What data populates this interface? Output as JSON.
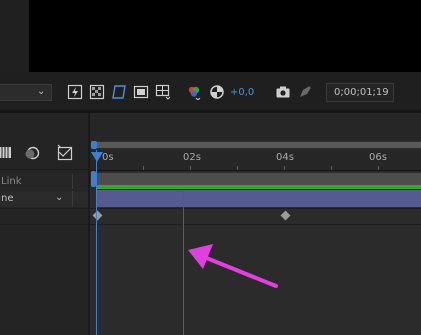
{
  "toolbar": {
    "zoom_value": "+0,0",
    "timecode": "0;00;01;19",
    "icons": [
      "fast-previews-icon",
      "transparency-grid-icon",
      "mask-visibility-icon",
      "region-of-interest-icon",
      "guides-grid-icon",
      "color-channels-icon",
      "exposure-reset-icon",
      "snapshot-camera-icon",
      "show-snapshot-icon"
    ]
  },
  "timeline": {
    "ruler_labels": [
      "0s",
      "02s",
      "04s",
      "06s"
    ],
    "column_header": {
      "parent_link_label": "Link"
    },
    "layer": {
      "parent_value": "ne"
    },
    "accent_colors": {
      "playhead": "#3d7fd3",
      "layer_bar": "#555a8f",
      "work_area": "#2fa82f",
      "red_line": "#d22a2a",
      "annotation_arrow": "#e040e0"
    }
  }
}
